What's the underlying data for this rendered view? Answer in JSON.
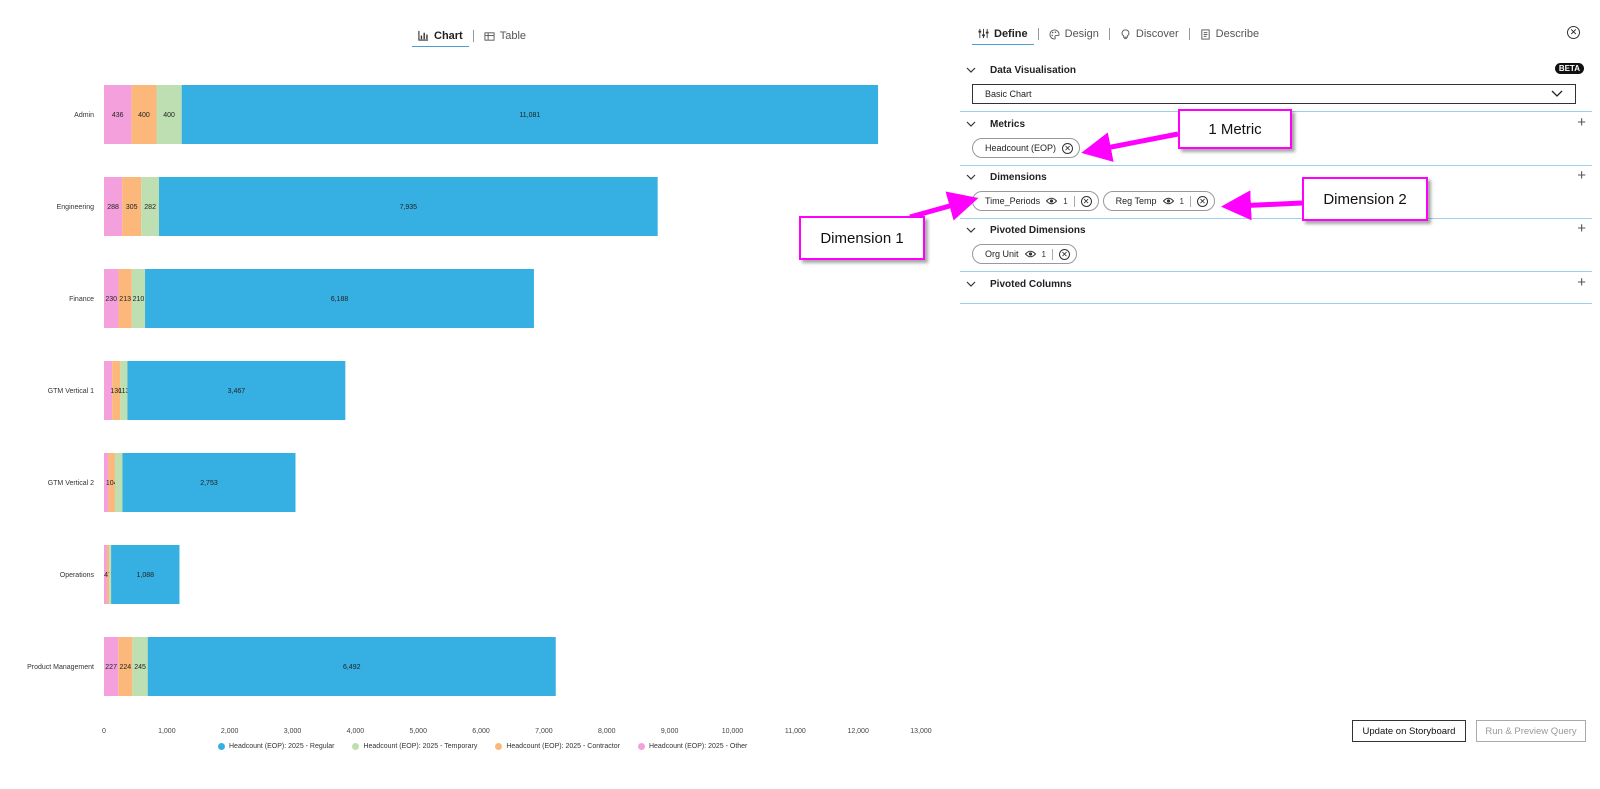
{
  "view_tabs": [
    {
      "label": "Chart",
      "icon": "bar-chart-icon",
      "active": true
    },
    {
      "label": "Table",
      "icon": "table-icon",
      "active": false
    }
  ],
  "panel": {
    "tabs": [
      {
        "label": "Define",
        "icon": "sliders-icon",
        "active": true
      },
      {
        "label": "Design",
        "icon": "palette-icon",
        "active": false
      },
      {
        "label": "Discover",
        "icon": "lightbulb-icon",
        "active": false
      },
      {
        "label": "Describe",
        "icon": "document-icon",
        "active": false
      }
    ],
    "sections": {
      "data_visualisation": {
        "title": "Data Visualisation",
        "badge": "BETA",
        "select_value": "Basic Chart"
      },
      "metrics": {
        "title": "Metrics",
        "chips": [
          {
            "label": "Headcount (EOP)"
          }
        ]
      },
      "dimensions": {
        "title": "Dimensions",
        "chips": [
          {
            "label": "Time_Periods",
            "count": "1"
          },
          {
            "label": "Reg Temp",
            "count": "1"
          }
        ]
      },
      "pivoted_dimensions": {
        "title": "Pivoted Dimensions",
        "chips": [
          {
            "label": "Org Unit",
            "count": "1"
          }
        ]
      },
      "pivoted_columns": {
        "title": "Pivoted Columns"
      }
    },
    "buttons": {
      "update": "Update on Storyboard",
      "run": "Run & Preview Query"
    }
  },
  "annotations": {
    "metric": "1 Metric",
    "dimension1": "Dimension 1",
    "dimension2": "Dimension 2",
    "color": "#ff00ff"
  },
  "chart_data": {
    "type": "bar",
    "orientation": "horizontal",
    "stacked": true,
    "categories": [
      "Admin",
      "Engineering",
      "Finance",
      "GTM Vertical 1",
      "GTM Vertical 2",
      "Operations",
      "Product Management"
    ],
    "series": [
      {
        "name": "Headcount (EOP): 2025 - Other",
        "color": "#f4a0dc",
        "values": [
          436,
          288,
          230,
          130,
          70,
          47,
          227
        ]
      },
      {
        "name": "Headcount (EOP): 2025 - Contractor",
        "color": "#fbb87a",
        "values": [
          400,
          305,
          213,
          130,
          104,
          36,
          224
        ]
      },
      {
        "name": "Headcount (EOP): 2025 - Temporary",
        "color": "#bedfb1",
        "values": [
          400,
          282,
          210,
          113,
          120,
          30,
          245
        ]
      },
      {
        "name": "Headcount (EOP): 2025 - Regular",
        "color": "#36b0e2",
        "values": [
          11081,
          7935,
          6188,
          3467,
          2753,
          1088,
          6492
        ]
      }
    ],
    "data_labels": [
      [
        "436",
        "400",
        "400",
        "11,081"
      ],
      [
        "288",
        "305",
        "282",
        "7,935"
      ],
      [
        "230",
        "213",
        "210",
        "6,188"
      ],
      [
        "",
        "130",
        "113",
        "3,467"
      ],
      [
        "",
        "104",
        "",
        "2,753"
      ],
      [
        "",
        "47",
        "",
        "1,088"
      ],
      [
        "227",
        "224",
        "245",
        "6,492"
      ]
    ],
    "x_ticks": [
      "0",
      "1,000",
      "2,000",
      "3,000",
      "4,000",
      "5,000",
      "6,000",
      "7,000",
      "8,000",
      "9,000",
      "10,000",
      "11,000",
      "12,000",
      "13,000"
    ],
    "xlim": [
      0,
      13000
    ],
    "legend_order": [
      "Headcount (EOP): 2025 - Regular",
      "Headcount (EOP): 2025 - Temporary",
      "Headcount (EOP): 2025 - Contractor",
      "Headcount (EOP): 2025 - Other"
    ],
    "legend_position": "bottom"
  }
}
